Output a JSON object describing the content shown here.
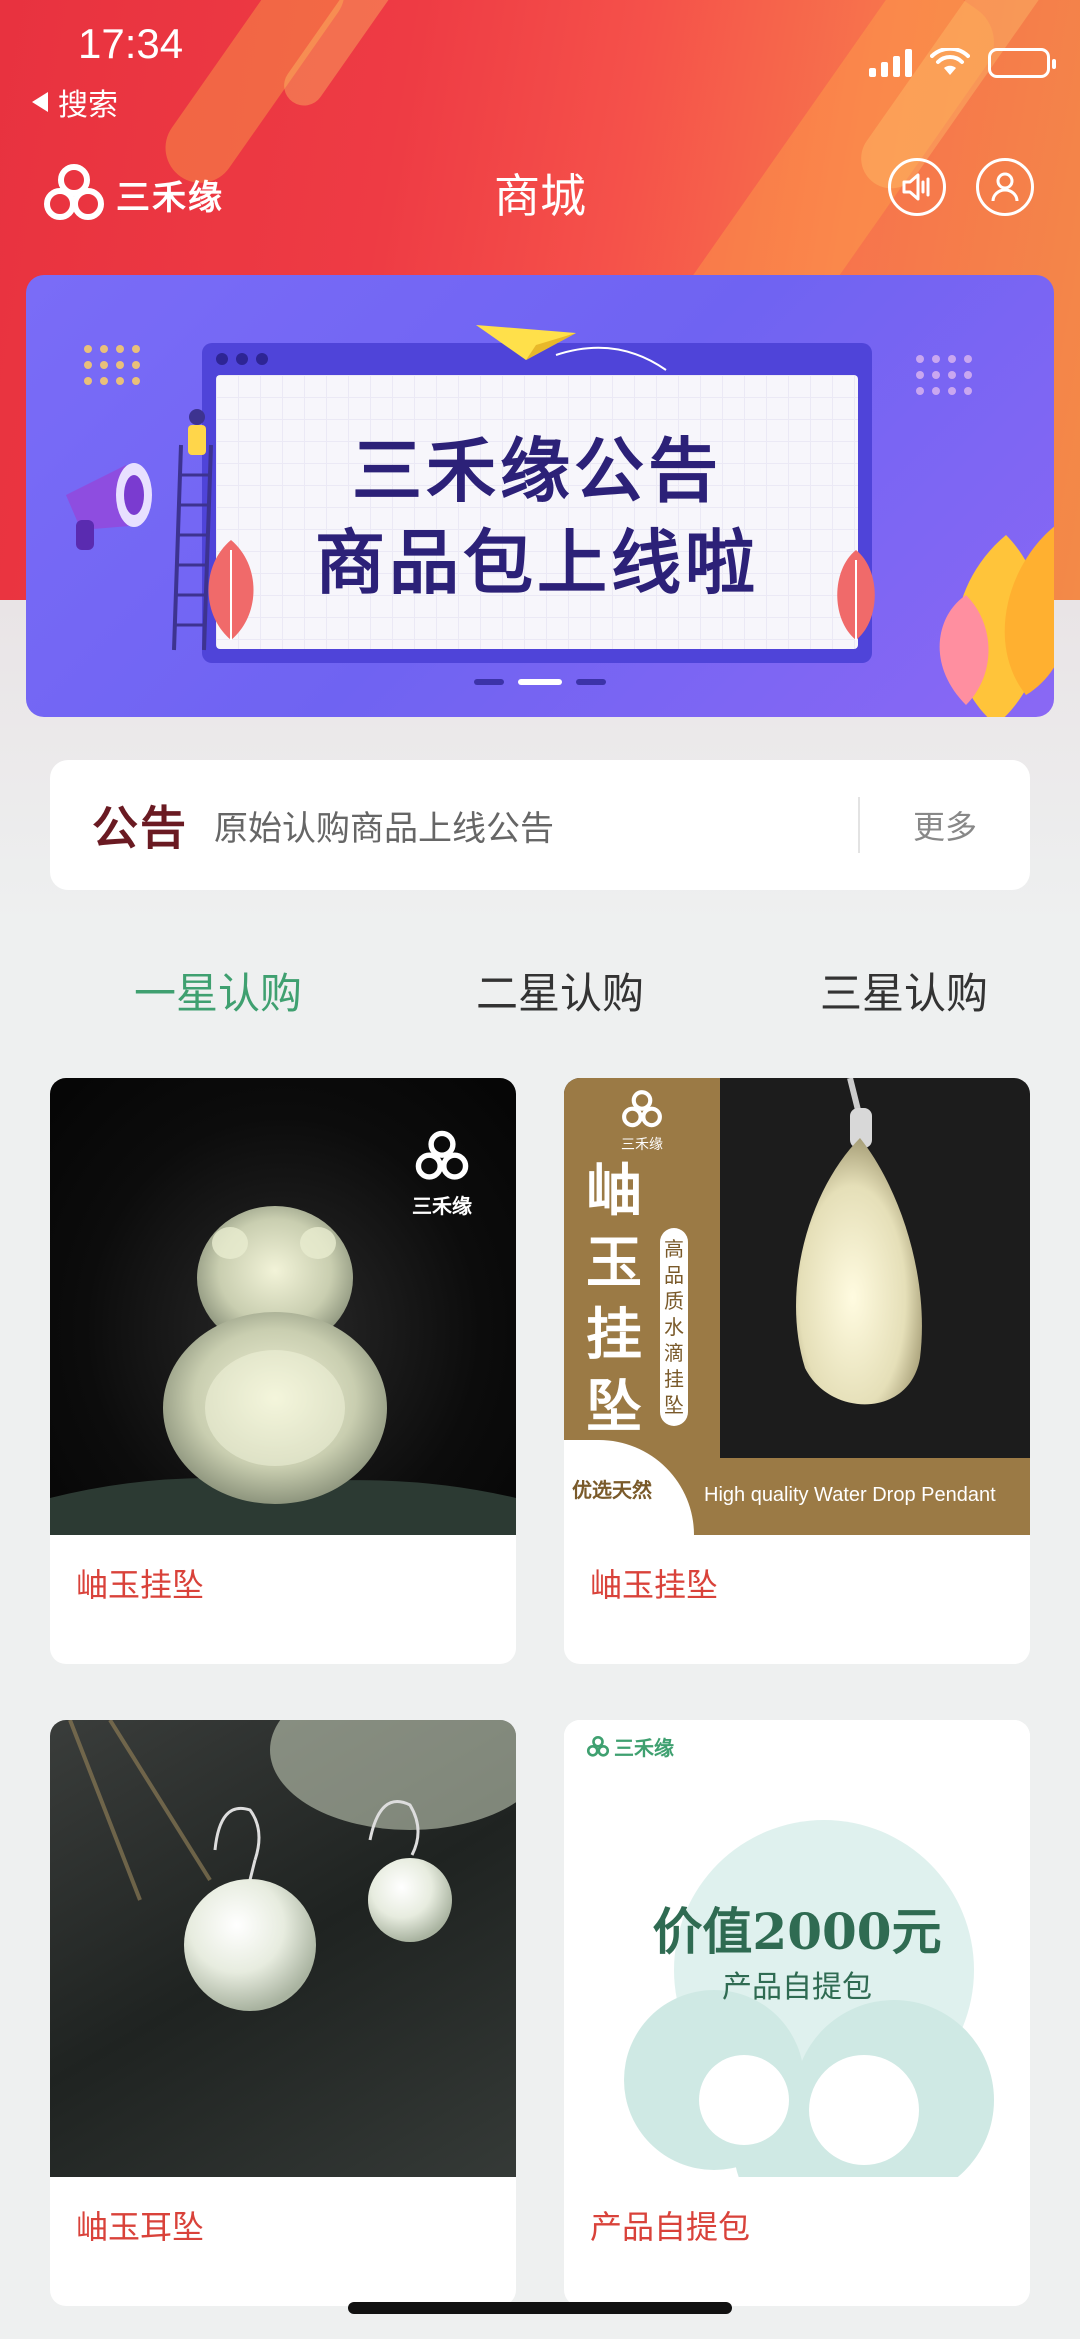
{
  "status_bar": {
    "time": "17:34",
    "back_label": "搜索"
  },
  "nav": {
    "logo_text": "三禾缘",
    "title": "商城"
  },
  "banner": {
    "line1": "三禾缘公告",
    "line2": "商品包上线啦",
    "page_count": 3,
    "active_page": 2
  },
  "notice": {
    "tag": "公告",
    "text": "原始认购商品上线公告",
    "more_label": "更多"
  },
  "tabs": [
    {
      "label": "一星认购",
      "active": true
    },
    {
      "label": "二星认购",
      "active": false
    },
    {
      "label": "三星认购",
      "active": false
    }
  ],
  "products": [
    {
      "name": "岫玉挂坠",
      "image": "gourd-jade-pendant",
      "overlay": {
        "logo": "三禾缘"
      }
    },
    {
      "name": "岫玉挂坠",
      "image": "water-drop-jade-pendant",
      "overlay": {
        "logo": "三禾缘",
        "title": "岫玉挂坠",
        "subtitle": "高品质水滴挂坠",
        "badge": "优选天然",
        "caption": "High quality Water Drop Pendant"
      }
    },
    {
      "name": "岫玉耳坠",
      "image": "jade-earrings"
    },
    {
      "name": "产品自提包",
      "image": "pickup-package-poster",
      "overlay": {
        "logo": "三禾缘",
        "headline": "价值2000元",
        "subhead": "产品自提包"
      }
    }
  ],
  "colors": {
    "header_red": "#e8323f",
    "accent_green": "#3fa070",
    "product_name_red": "#d9423a",
    "banner_purple": "#7a6cf7"
  }
}
